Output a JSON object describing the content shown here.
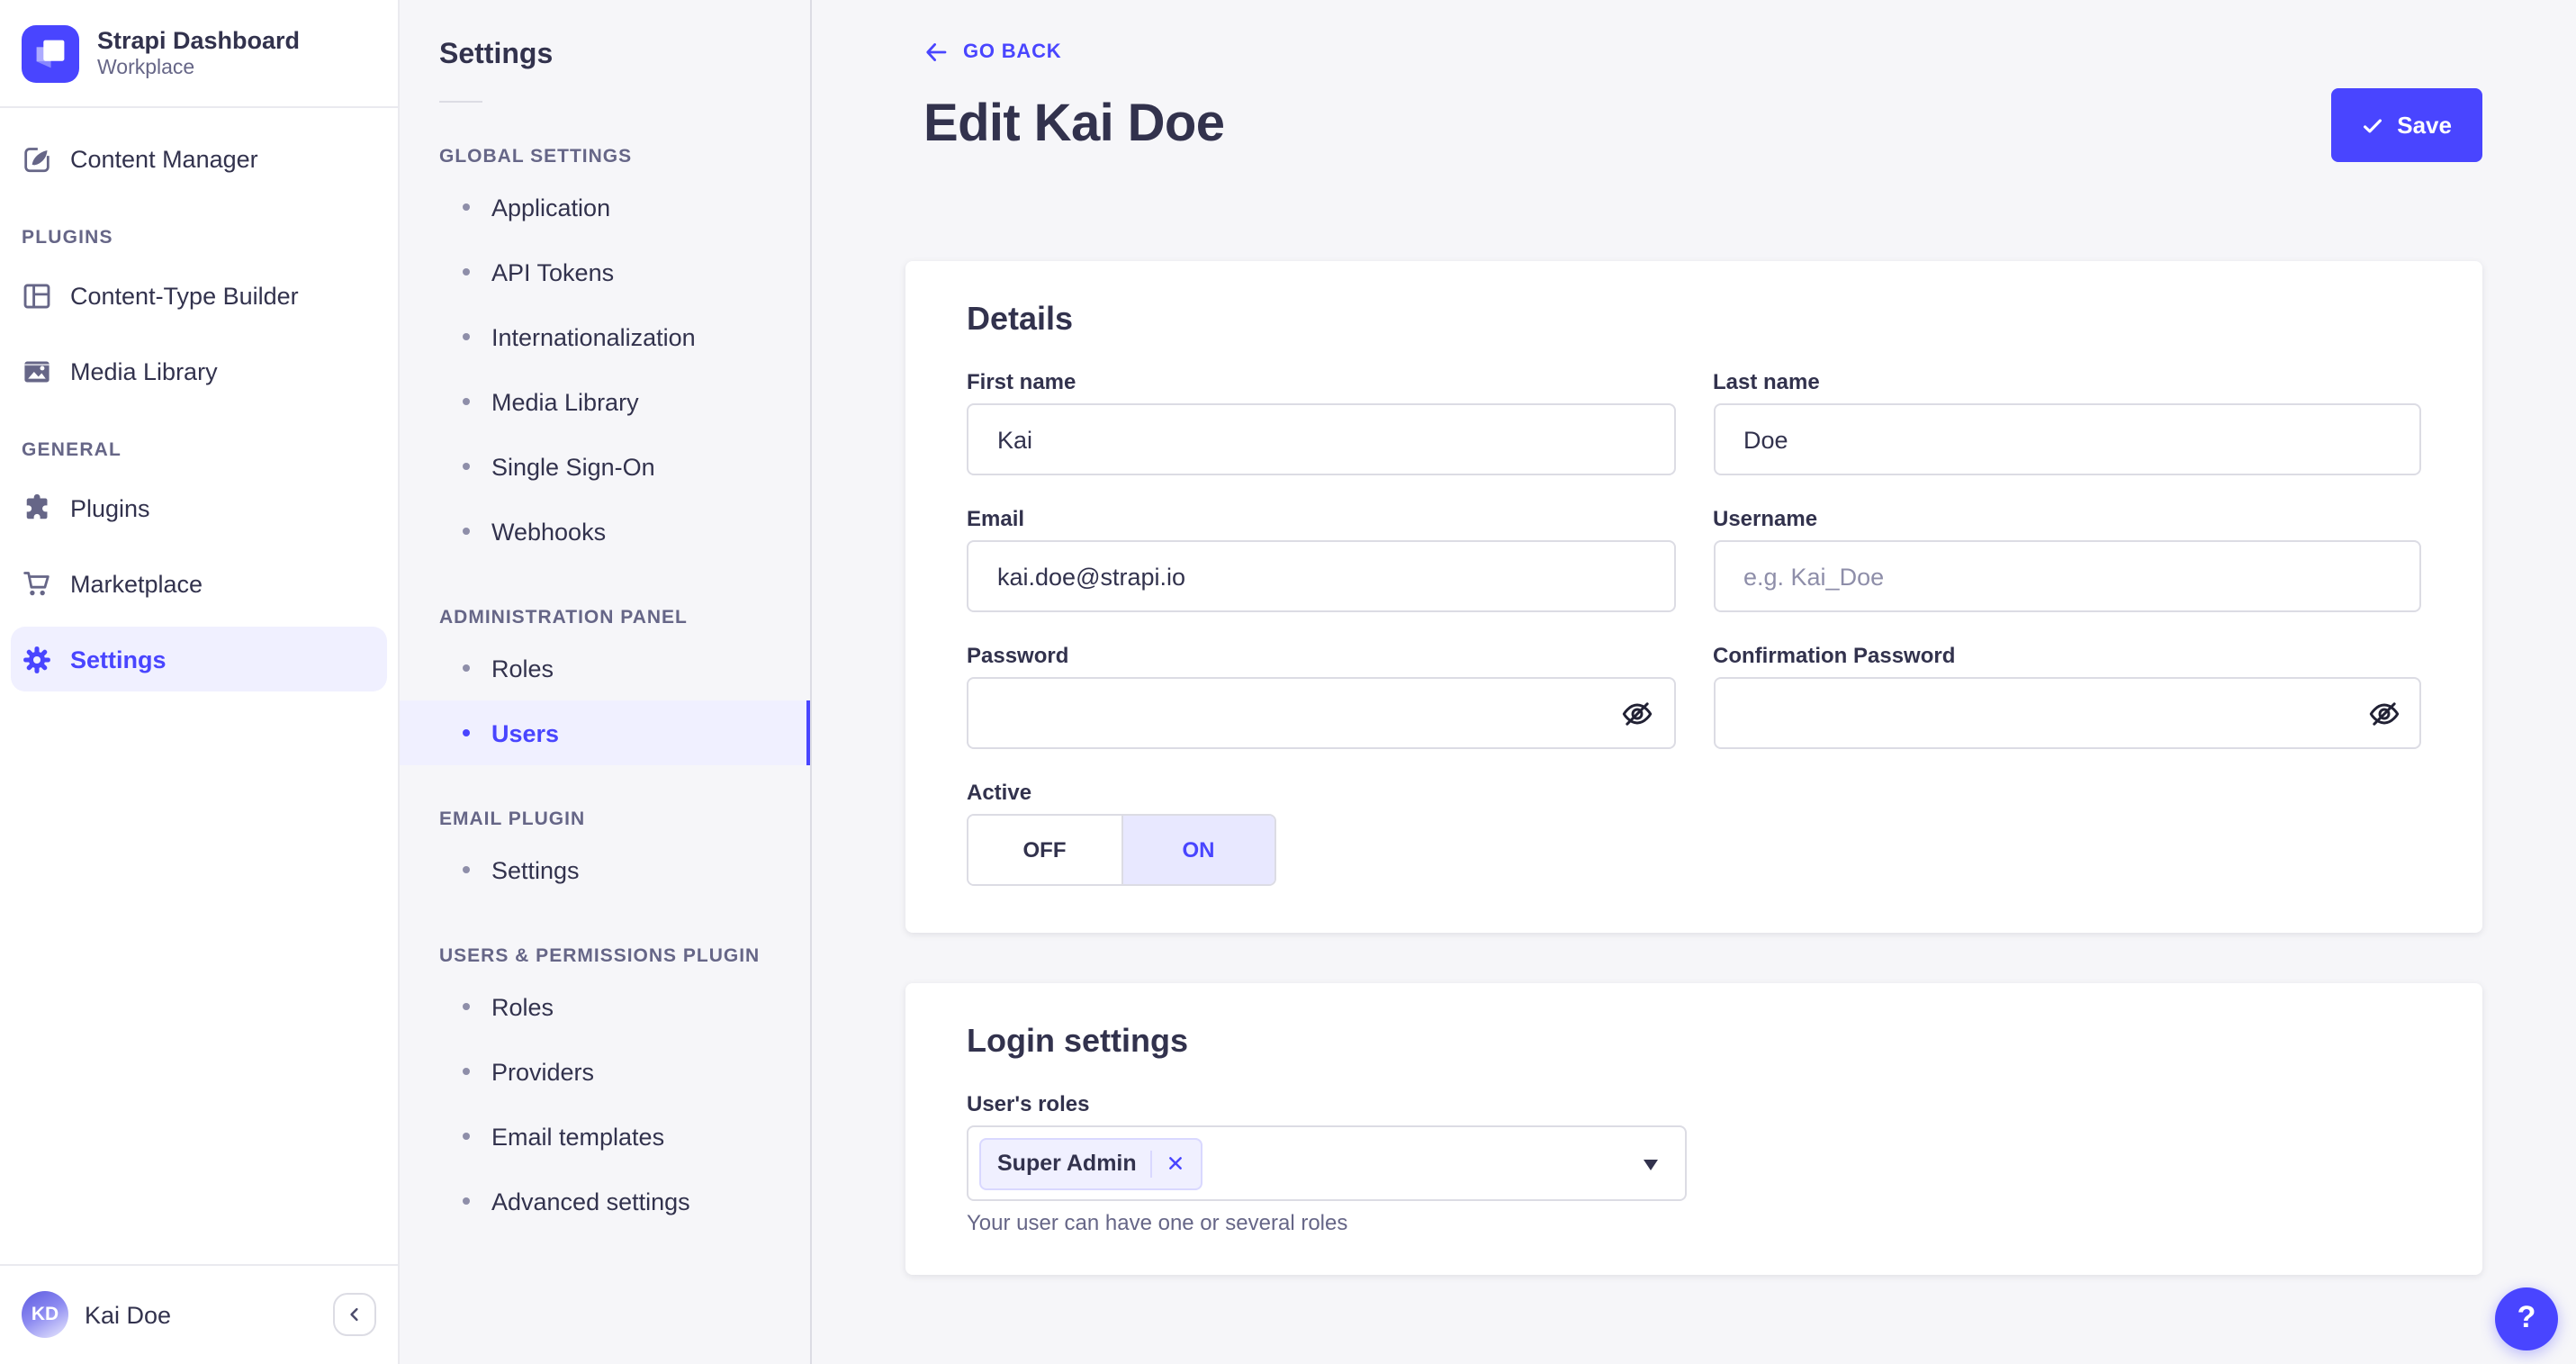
{
  "brand": {
    "title": "Strapi Dashboard",
    "subtitle": "Workplace"
  },
  "primary_nav": {
    "content_manager": "Content Manager",
    "sections": [
      {
        "label": "PLUGINS",
        "items": [
          {
            "label": "Content-Type Builder"
          },
          {
            "label": "Media Library"
          }
        ]
      },
      {
        "label": "GENERAL",
        "items": [
          {
            "label": "Plugins"
          },
          {
            "label": "Marketplace"
          },
          {
            "label": "Settings"
          }
        ]
      }
    ],
    "user": {
      "initials": "KD",
      "name": "Kai Doe"
    }
  },
  "settings_nav": {
    "title": "Settings",
    "sections": [
      {
        "label": "GLOBAL SETTINGS",
        "items": [
          "Application",
          "API Tokens",
          "Internationalization",
          "Media Library",
          "Single Sign-On",
          "Webhooks"
        ]
      },
      {
        "label": "ADMINISTRATION PANEL",
        "items": [
          "Roles",
          "Users"
        ]
      },
      {
        "label": "EMAIL PLUGIN",
        "items": [
          "Settings"
        ]
      },
      {
        "label": "USERS & PERMISSIONS PLUGIN",
        "items": [
          "Roles",
          "Providers",
          "Email templates",
          "Advanced settings"
        ]
      }
    ],
    "active_item": "Users"
  },
  "header": {
    "back_label": "GO BACK",
    "title": "Edit Kai Doe",
    "save_label": "Save"
  },
  "details_card": {
    "title": "Details",
    "fields": {
      "first_name": {
        "label": "First name",
        "value": "Kai"
      },
      "last_name": {
        "label": "Last name",
        "value": "Doe"
      },
      "email": {
        "label": "Email",
        "value": "kai.doe@strapi.io"
      },
      "username": {
        "label": "Username",
        "placeholder": "e.g. Kai_Doe"
      },
      "password": {
        "label": "Password",
        "value": ""
      },
      "confirmation_password": {
        "label": "Confirmation Password",
        "value": ""
      },
      "active": {
        "label": "Active",
        "off_label": "OFF",
        "on_label": "ON",
        "value": "ON"
      }
    }
  },
  "login_card": {
    "title": "Login settings",
    "roles": {
      "label": "User's roles",
      "selected": [
        "Super Admin"
      ],
      "hint": "Your user can have one or several roles"
    }
  },
  "help": {
    "label": "?"
  },
  "colors": {
    "primary": "#4945ff",
    "primary_light": "#f0f0ff",
    "toggle_on_bg": "#e8e8ff",
    "text_dark": "#32324d",
    "text_muted": "#666687",
    "placeholder": "#8e8ea9",
    "border": "#dcdce4",
    "border_light": "#eaeaef",
    "page_bg": "#f6f6f9"
  }
}
